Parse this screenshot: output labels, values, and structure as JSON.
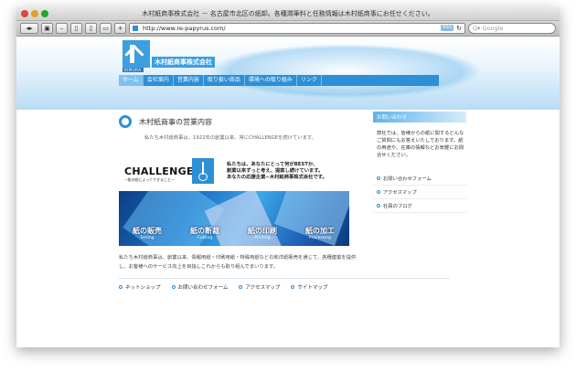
{
  "window": {
    "title": "木村紙商事株式会社 － 名古屋市北区の紙卸。各種潤筆料と任務情報は木村紙商事にお任せください。"
  },
  "browser": {
    "url": "http://www.re-papyrus.com/",
    "rss": "RSS",
    "search_placeholder": "Google",
    "search_prefix": "Q▾"
  },
  "site": {
    "company_name": "木村紙商事株式会社",
    "logo_sub": "KIMURA",
    "nav": [
      "ホーム",
      "会社案内",
      "営業内容",
      "取り扱い商品",
      "環境への取り組み",
      "リンク"
    ],
    "page_title": "木村紙商事の営業内容",
    "intro": "私たち木村紙商事は、1922年の創業以来、常にCHALLENGEを続けています。",
    "challenge": {
      "word": "CHALLENGE",
      "sub": "−枚の紙によってできること−"
    },
    "slogan": [
      "私たちは、あなたにとって何がBESTか、",
      "創業以来ずっと考え、提案し続けています。",
      "あなたの応援企業−木村紙商事株式会社です。"
    ],
    "banner": [
      {
        "ja": "紙の販売",
        "en": "Selling"
      },
      {
        "ja": "紙の断裁",
        "en": "Cutting"
      },
      {
        "ja": "紙の印刷",
        "en": "Printing"
      },
      {
        "ja": "紙の加工",
        "en": "Processing"
      }
    ],
    "company_text": "私たち木村紙商事は、創業以来、情報用紙・印刷用紙・特殊用紙などの和洋紙販売を通じて、各種建築を提供し、お客様へのサービス向上を目指しこれからも取り組んでまいります。",
    "footer_links": [
      "ネットショップ",
      "お問い合わせフォーム",
      "アクセスマップ",
      "サイトマップ"
    ],
    "sidebar": {
      "heading": "お問い合わせ",
      "text": "弊社では、皆様からの紙に関するどんなご質問にもお答えいたしております。紙の用途や、在庫の情報などお気軽にお問合せください。",
      "links": [
        "お問い合わせフォーム",
        "アクセスマップ",
        "社員のブログ"
      ]
    }
  }
}
